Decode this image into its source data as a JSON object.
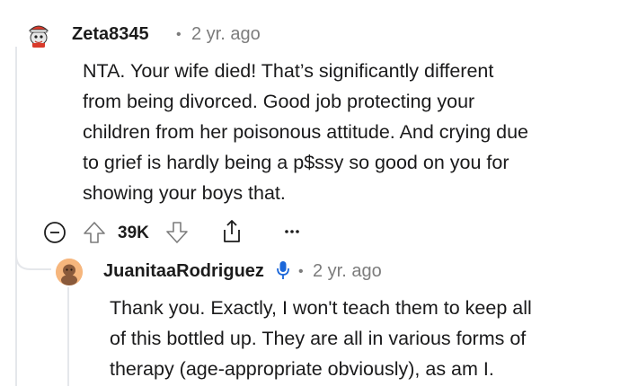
{
  "comment": {
    "username": "Zeta8345",
    "separator": "•",
    "time": "2 yr. ago",
    "lines": [
      "NTA. Your wife died! That’s significantly different",
      "from being divorced. Good job protecting your",
      "children from her poisonous attitude. And crying due",
      "to grief is hardly being a p$ssy so good on you for",
      "showing your boys that."
    ],
    "actions": {
      "collapse_icon": "minus-circle-icon",
      "upvote_icon": "arrow-up-icon",
      "vote_count": "39K",
      "downvote_icon": "arrow-down-icon",
      "share_icon": "share-icon",
      "more_icon": "ellipsis-icon"
    }
  },
  "reply": {
    "username": "JuanitaaRodriguez",
    "badge_icon": "microphone-icon",
    "separator": "•",
    "time": "2 yr. ago",
    "lines": [
      "Thank you. Exactly, I won't teach them to keep all",
      "of this bottled up. They are all in various forms of",
      "therapy (age-appropriate obviously), as am I."
    ]
  },
  "colors": {
    "thread_line": "#e5e7eb",
    "meta_text": "#7c7c7c",
    "mic_blue": "#1a66d9",
    "reply_avatar_bg": "#f6b67d"
  }
}
